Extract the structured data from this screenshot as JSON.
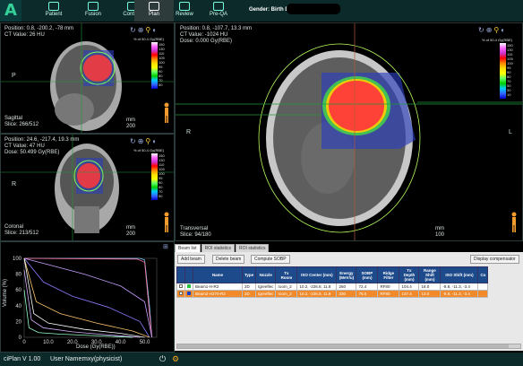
{
  "app": {
    "logo": "A",
    "version": "ciPlan V 1.00",
    "user_label": "User Name:",
    "user_value": "mxy(physicist)"
  },
  "nav": [
    {
      "label": "Patient",
      "name": "nav-patient"
    },
    {
      "label": "Fusion",
      "name": "nav-fusion"
    },
    {
      "label": "Contour",
      "name": "nav-contour"
    },
    {
      "label": "Plan",
      "name": "nav-plan",
      "active": true
    },
    {
      "label": "Review",
      "name": "nav-review"
    },
    {
      "label": "Pre-QA",
      "name": "nav-preqa"
    }
  ],
  "header": {
    "gender_birth": "Gender:  Birth Da"
  },
  "views": {
    "sagittal": {
      "line1": "Position: 0.8, -200.2, -78 mm",
      "line2": "CT Value: 26 HU",
      "name": "Sagittal",
      "slice": "Slice: 266/512",
      "scale": "200",
      "scale_unit": "mm",
      "orient": "P"
    },
    "coronal": {
      "line1": "Position: 24.6, -217.4, 19.3 mm",
      "line2": "CT Value: 47 HU",
      "line3": "Dose: 50.499 Gy(RBE)",
      "name": "Coronal",
      "slice": "Slice: 213/512",
      "scale": "200",
      "scale_unit": "mm",
      "orient": "R"
    },
    "transversal": {
      "line1": "Position: 0.8, -107.7, 13.3 mm",
      "line2": "CT Value: -1024 HU",
      "line3": "Dose: 0.000 Gy(RBE)",
      "name": "Transversal",
      "slice": "Slice: 94/180",
      "scale": "100",
      "scale_unit": "mm",
      "orient_left": "R",
      "orient_right": "L"
    }
  },
  "colorbar": {
    "header": "% of 50.4 Gy(RBE)",
    "labels": [
      "150",
      "130",
      "110",
      "105",
      "100",
      "95",
      "90",
      "80",
      "70",
      "50",
      "30",
      "10"
    ],
    "colors": [
      "#ffffff",
      "#ff66ff",
      "#cc33cc",
      "#ff0000",
      "#ff8800",
      "#ffd000",
      "#ffff00",
      "#66ff66",
      "#00cc00",
      "#00ccff",
      "#3366ff",
      "#0000cc"
    ]
  },
  "dvh": {
    "ylabel": "Volume (%)",
    "xlabel": "Dose (Gy(RBE))",
    "xticks": [
      "0",
      "10.0",
      "20.0",
      "30.0",
      "40.0",
      "50.0"
    ],
    "yticks": [
      "100",
      "80",
      "60",
      "40",
      "20",
      "0"
    ]
  },
  "chart_data": {
    "type": "line",
    "title": "",
    "xlabel": "Dose (Gy(RBE))",
    "ylabel": "Volume (%)",
    "xlim": [
      0,
      55
    ],
    "ylim": [
      0,
      100
    ],
    "series": [
      {
        "color": "#7fd0ff",
        "x": [
          0,
          48,
          50,
          52,
          53
        ],
        "y": [
          100,
          100,
          98,
          40,
          0
        ]
      },
      {
        "color": "#ff6fa0",
        "x": [
          0,
          47,
          50,
          52,
          53
        ],
        "y": [
          100,
          99,
          95,
          30,
          0
        ]
      },
      {
        "color": "#c8a0ff",
        "x": [
          0,
          10,
          25,
          40,
          50,
          53
        ],
        "y": [
          100,
          92,
          80,
          65,
          45,
          0
        ]
      },
      {
        "color": "#8a7cff",
        "x": [
          0,
          8,
          20,
          35,
          48,
          52
        ],
        "y": [
          100,
          70,
          52,
          38,
          20,
          0
        ]
      },
      {
        "color": "#ffc56f",
        "x": [
          0,
          5,
          15,
          30,
          45,
          52
        ],
        "y": [
          100,
          45,
          30,
          18,
          8,
          0
        ]
      },
      {
        "color": "#ffffff",
        "x": [
          0,
          4,
          10,
          25,
          40,
          50
        ],
        "y": [
          100,
          30,
          18,
          10,
          5,
          0
        ]
      },
      {
        "color": "#d6b0ff",
        "x": [
          0,
          3,
          8,
          20,
          35,
          48
        ],
        "y": [
          85,
          22,
          12,
          7,
          3,
          0
        ]
      },
      {
        "color": "#99ffcc",
        "x": [
          0,
          2,
          6,
          15,
          30,
          45
        ],
        "y": [
          60,
          12,
          6,
          4,
          2,
          0
        ]
      }
    ]
  },
  "beam_panel": {
    "tabs": [
      "Beam list",
      "ROI statistics",
      "ROI statistics"
    ],
    "add_beam": "Add beam",
    "delete_beam": "Delete beam",
    "compute_sobp": "Compute SOBP",
    "display_compensator": "Display compensator",
    "columns": [
      "",
      "",
      "Name",
      "Type",
      "Nozzle",
      "Tx Room",
      "ISO Center (mm)",
      "Energy (MeV/u)",
      "SOBP (mm)",
      "Ridge Filter",
      "Tx Depth (mm)",
      "Range Shift (mm)",
      "ISO Shift (mm)",
      "Co"
    ],
    "rows": [
      {
        "color": "#2bbf3a",
        "name": "Beam1-H-R2",
        "type": "2D",
        "nozzle": "tgreeflec",
        "room": "room_2",
        "iso": "10.2, -226.8, 11.8",
        "energy": "260",
        "sobp": "72.4",
        "ridge": "RF80",
        "depth": "104.4",
        "range_shift": "18.0",
        "iso_shift": "-8.8, -11.3, -3.4",
        "co": "",
        "selected": false
      },
      {
        "color": "#1a40c8",
        "name": "Beam2-H270-R2",
        "type": "2D",
        "nozzle": "tgreeflec",
        "room": "room_2",
        "iso": "10.2, -226.8, 11.8",
        "energy": "330",
        "sobp": "75.0",
        "ridge": "RF80",
        "depth": "137.4",
        "range_shift": "13.0",
        "iso_shift": "-8.8, -11.3, -3.4",
        "co": "",
        "selected": true
      }
    ]
  }
}
